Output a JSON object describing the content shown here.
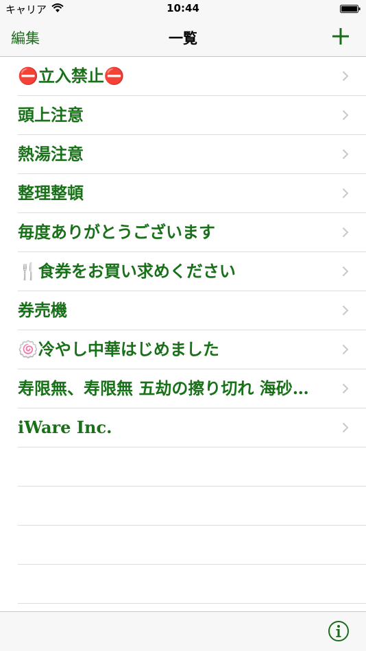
{
  "status_bar": {
    "carrier": "キャリア",
    "time": "10:44"
  },
  "nav": {
    "title": "一覧",
    "edit_label": "編集"
  },
  "items": [
    {
      "label": "⛔立入禁止⛔"
    },
    {
      "label": "頭上注意"
    },
    {
      "label": "熱湯注意"
    },
    {
      "label": "整理整頓"
    },
    {
      "label": "毎度ありがとうございます"
    },
    {
      "label": "🍴食券をお買い求めください"
    },
    {
      "label": "券売機"
    },
    {
      "label": "🍥冷やし中華はじめました"
    },
    {
      "label": "寿限無、寿限無 五劫の擦り切れ 海砂…"
    },
    {
      "label": "iWare Inc."
    }
  ],
  "colors": {
    "accent": "#1a6b1a",
    "item_text": "#187018",
    "separator": "#dcdcdc",
    "chevron": "#c7c7cc"
  },
  "icons": {
    "add": "plus-icon",
    "info": "info-icon",
    "row_disclosure": "chevron-right-icon"
  }
}
